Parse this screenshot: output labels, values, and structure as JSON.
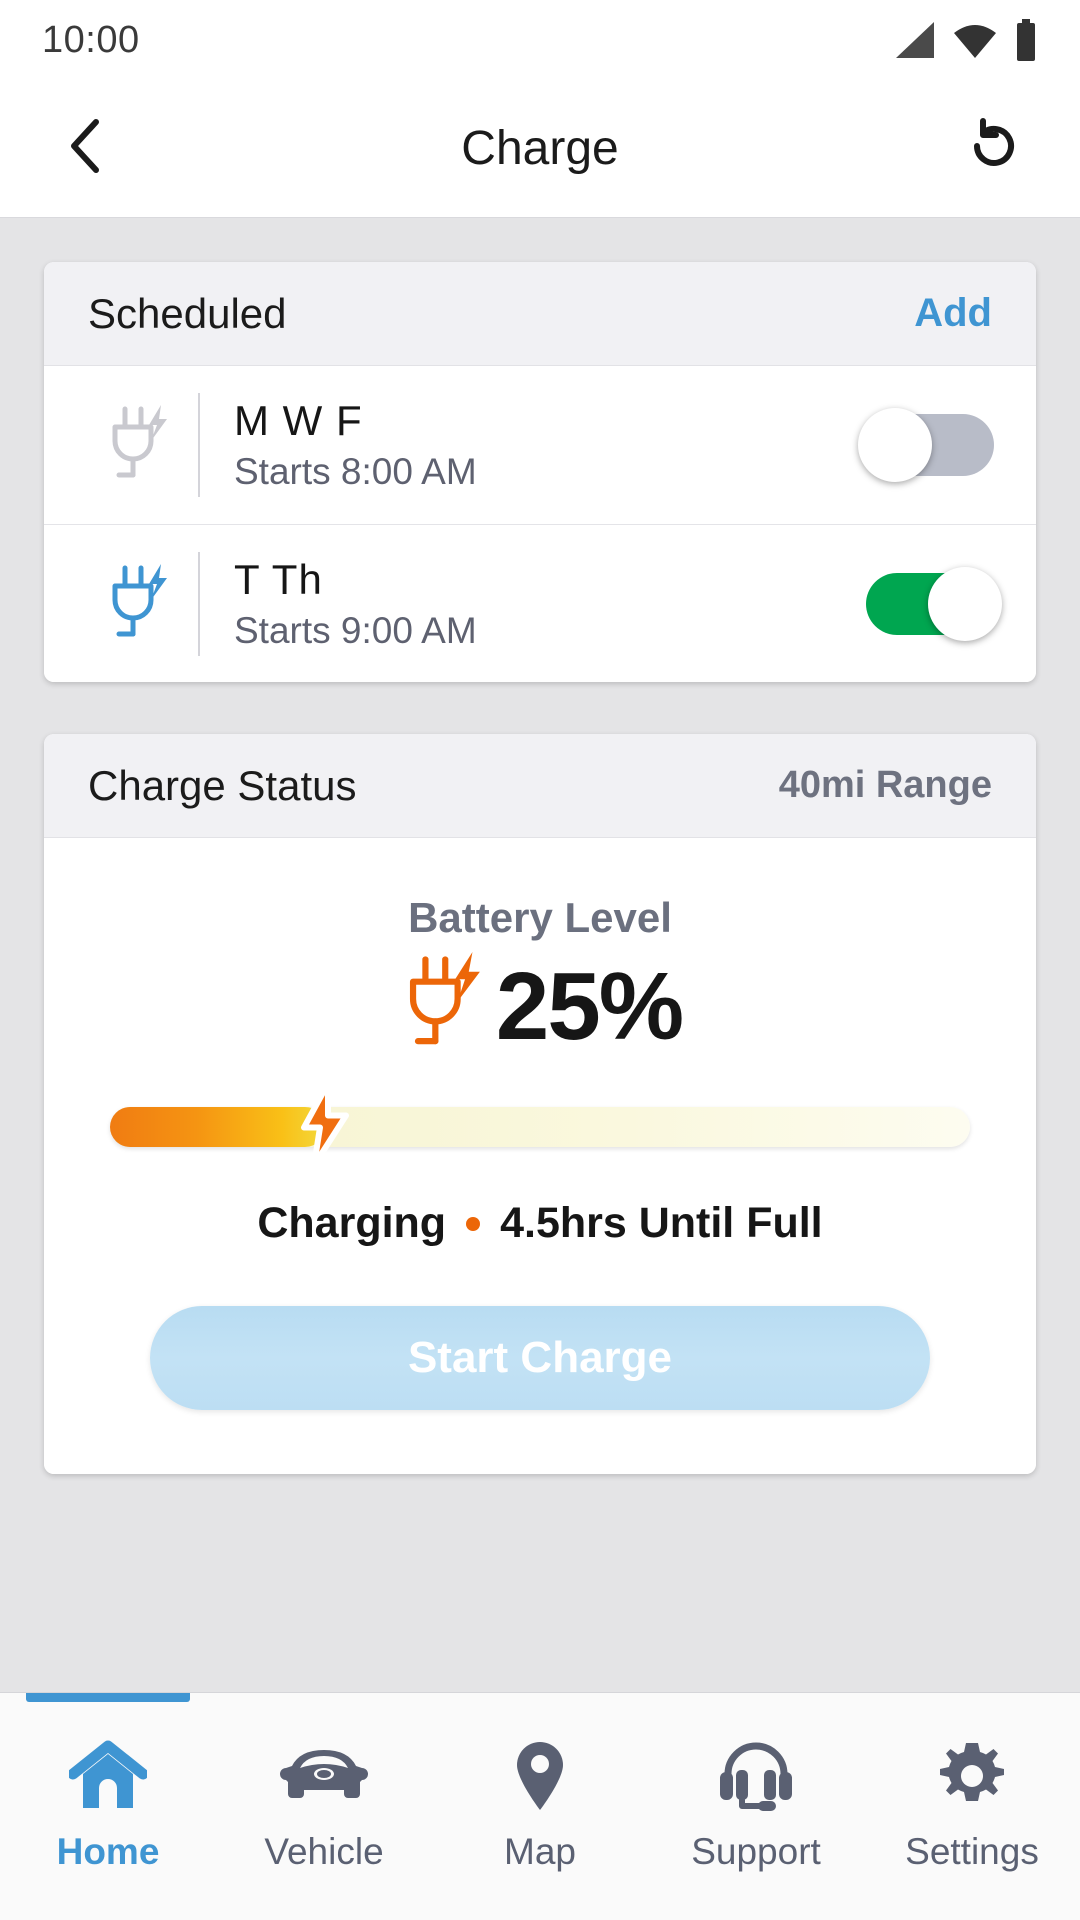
{
  "statusbar": {
    "time": "10:00",
    "icons": [
      "signal-icon",
      "wifi-icon",
      "battery-icon"
    ]
  },
  "header": {
    "back_icon": "chevron-left-icon",
    "title": "Charge",
    "refresh_icon": "refresh-ccw-icon"
  },
  "scheduled_card": {
    "title": "Scheduled",
    "add_label": "Add",
    "rows": [
      {
        "icon": "charge-plug-icon",
        "icon_color": "#c9c9cf",
        "days": "M W F",
        "time": "Starts 8:00 AM",
        "enabled": false
      },
      {
        "icon": "charge-plug-icon",
        "icon_color": "#3f95d2",
        "days": "T Th",
        "time": "Starts 9:00 AM",
        "enabled": true
      }
    ]
  },
  "charge_status_card": {
    "title": "Charge Status",
    "range": "40mi Range",
    "battery_label": "Battery Level",
    "battery_icon": "charge-plug-icon",
    "battery_percent": "25%",
    "battery_percent_value": 25,
    "status_text": "Charging",
    "time_remaining": "4.5hrs Until Full",
    "start_button": "Start Charge"
  },
  "bottom_nav": {
    "items": [
      {
        "label": "Home",
        "icon": "home-icon",
        "active": true
      },
      {
        "label": "Vehicle",
        "icon": "car-icon",
        "active": false
      },
      {
        "label": "Map",
        "icon": "map-pin-icon",
        "active": false
      },
      {
        "label": "Support",
        "icon": "headset-icon",
        "active": false
      },
      {
        "label": "Settings",
        "icon": "gear-icon",
        "active": false
      }
    ]
  },
  "colors": {
    "accent_blue": "#3f95d2",
    "toggle_on_green": "#00a650",
    "charge_orange": "#ec6608",
    "muted_gray": "#5a6072"
  }
}
